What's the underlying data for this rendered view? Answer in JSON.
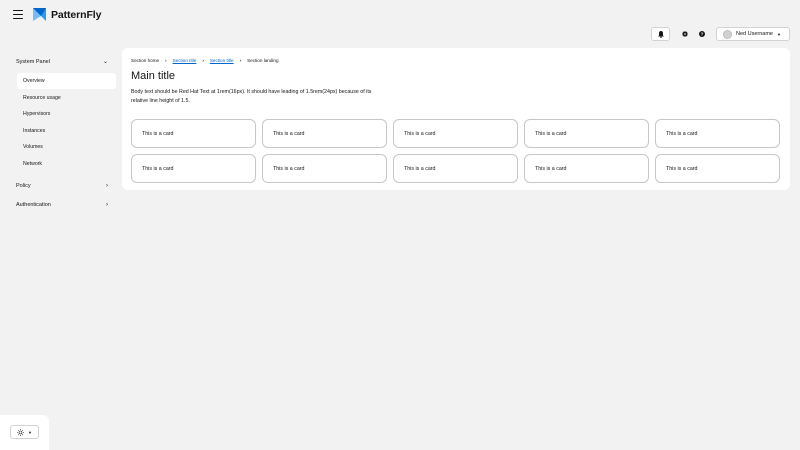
{
  "brand": {
    "name": "PatternFly",
    "accent": "#0066cc"
  },
  "header": {
    "user_name": "Ned Username",
    "icons": [
      "bell-icon",
      "gear-icon",
      "question-circle-icon"
    ]
  },
  "sidebar": {
    "system_panel": {
      "label": "System Panel",
      "items": [
        "Overview",
        "Resource usage",
        "Hypervisors",
        "Instances",
        "Volumes",
        "Network"
      ],
      "active": "Overview"
    },
    "policy": "Policy",
    "authentication": "Authentication"
  },
  "breadcrumb": [
    "Section home",
    "Section title",
    "Section title",
    "Section landing"
  ],
  "main": {
    "title": "Main title",
    "body": "Body text should be Red Hat Text at 1rem(16px). It should have leading of 1.5rem(24px) because of its relative line height of 1.5."
  },
  "cards": [
    "This is a card",
    "This is a card",
    "This is a card",
    "This is a card",
    "This is a card",
    "This is a card",
    "This is a card",
    "This is a card",
    "This is a card",
    "This is a card"
  ],
  "theme_toggle": {
    "icon": "sun-icon"
  }
}
